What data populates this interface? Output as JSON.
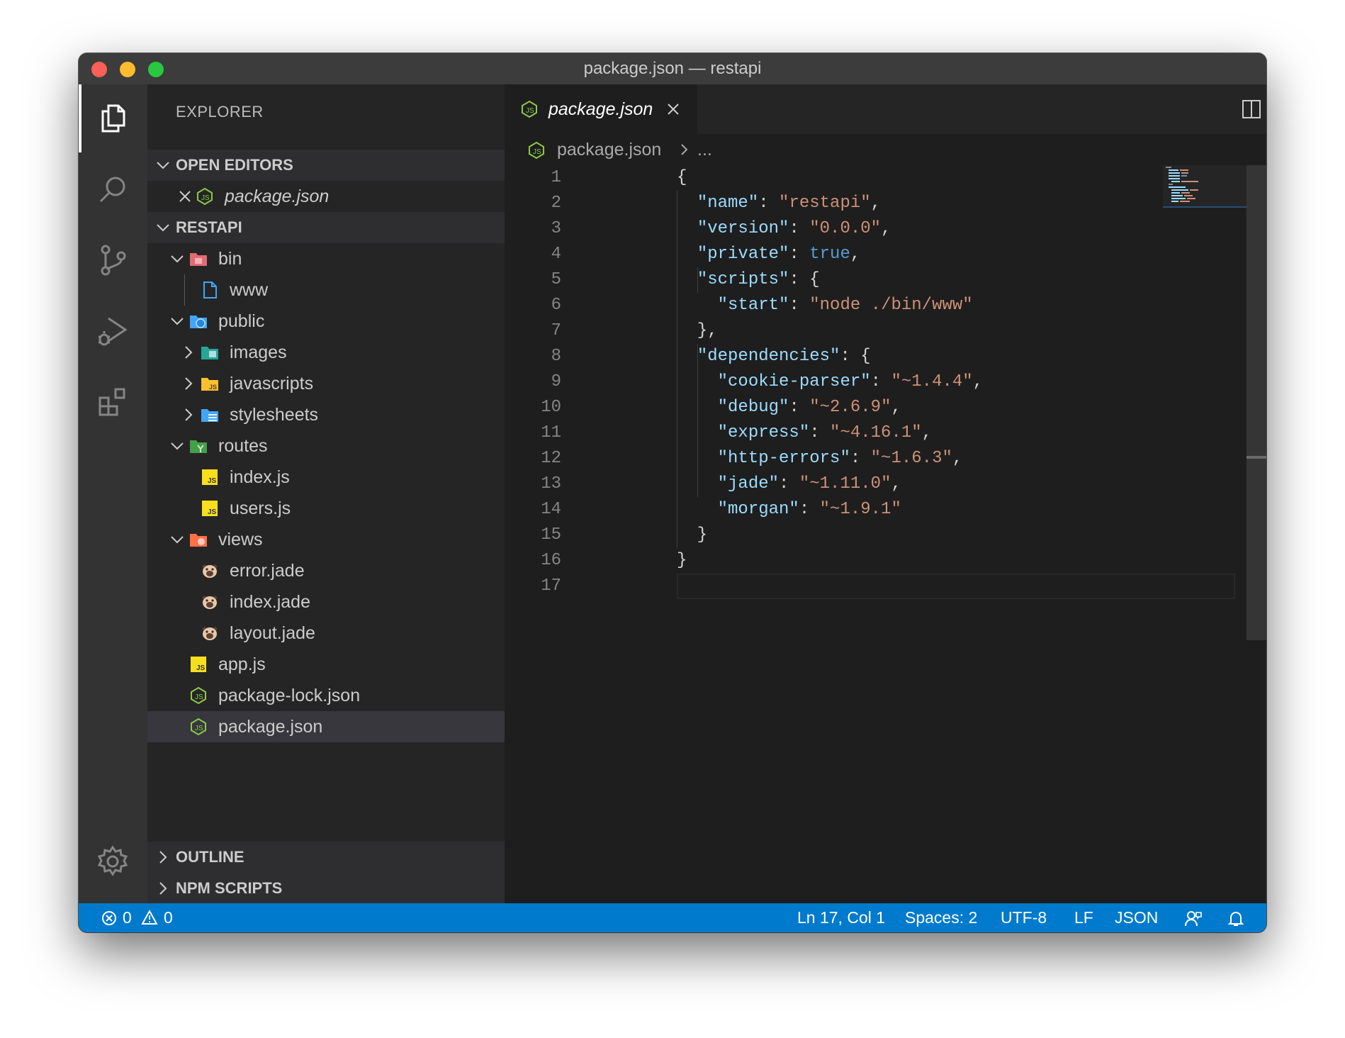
{
  "window": {
    "title": "package.json — restapi"
  },
  "sidebar": {
    "title": "EXPLORER",
    "open_editors": {
      "header": "OPEN EDITORS",
      "items": [
        {
          "label": "package.json"
        }
      ]
    },
    "project": {
      "header": "RESTAPI",
      "tree": [
        {
          "label": "bin"
        },
        {
          "label": "www"
        },
        {
          "label": "public"
        },
        {
          "label": "images"
        },
        {
          "label": "javascripts"
        },
        {
          "label": "stylesheets"
        },
        {
          "label": "routes"
        },
        {
          "label": "index.js"
        },
        {
          "label": "users.js"
        },
        {
          "label": "views"
        },
        {
          "label": "error.jade"
        },
        {
          "label": "index.jade"
        },
        {
          "label": "layout.jade"
        },
        {
          "label": "app.js"
        },
        {
          "label": "package-lock.json"
        },
        {
          "label": "package.json"
        }
      ]
    },
    "outline": {
      "header": "OUTLINE"
    },
    "npm_scripts": {
      "header": "NPM SCRIPTS"
    }
  },
  "editor": {
    "tab": {
      "label": "package.json"
    },
    "breadcrumb": {
      "file": "package.json",
      "more": "..."
    },
    "lines": [
      {
        "n": "1",
        "t": [
          [
            "p",
            "{"
          ]
        ]
      },
      {
        "n": "2",
        "t": [
          [
            "p",
            "  "
          ],
          [
            "k",
            "\"name\""
          ],
          [
            "p",
            ": "
          ],
          [
            "s",
            "\"restapi\""
          ],
          [
            "p",
            ","
          ]
        ]
      },
      {
        "n": "3",
        "t": [
          [
            "p",
            "  "
          ],
          [
            "k",
            "\"version\""
          ],
          [
            "p",
            ": "
          ],
          [
            "s",
            "\"0.0.0\""
          ],
          [
            "p",
            ","
          ]
        ]
      },
      {
        "n": "4",
        "t": [
          [
            "p",
            "  "
          ],
          [
            "k",
            "\"private\""
          ],
          [
            "p",
            ": "
          ],
          [
            "b",
            "true"
          ],
          [
            "p",
            ","
          ]
        ]
      },
      {
        "n": "5",
        "t": [
          [
            "p",
            "  "
          ],
          [
            "k",
            "\"scripts\""
          ],
          [
            "p",
            ": {"
          ]
        ]
      },
      {
        "n": "6",
        "t": [
          [
            "p",
            "    "
          ],
          [
            "k",
            "\"start\""
          ],
          [
            "p",
            ": "
          ],
          [
            "s",
            "\"node ./bin/www\""
          ]
        ]
      },
      {
        "n": "7",
        "t": [
          [
            "p",
            "  },"
          ]
        ]
      },
      {
        "n": "8",
        "t": [
          [
            "p",
            "  "
          ],
          [
            "k",
            "\"dependencies\""
          ],
          [
            "p",
            ": {"
          ]
        ]
      },
      {
        "n": "9",
        "t": [
          [
            "p",
            "    "
          ],
          [
            "k",
            "\"cookie-parser\""
          ],
          [
            "p",
            ": "
          ],
          [
            "s",
            "\"~1.4.4\""
          ],
          [
            "p",
            ","
          ]
        ]
      },
      {
        "n": "10",
        "t": [
          [
            "p",
            "    "
          ],
          [
            "k",
            "\"debug\""
          ],
          [
            "p",
            ": "
          ],
          [
            "s",
            "\"~2.6.9\""
          ],
          [
            "p",
            ","
          ]
        ]
      },
      {
        "n": "11",
        "t": [
          [
            "p",
            "    "
          ],
          [
            "k",
            "\"express\""
          ],
          [
            "p",
            ": "
          ],
          [
            "s",
            "\"~4.16.1\""
          ],
          [
            "p",
            ","
          ]
        ]
      },
      {
        "n": "12",
        "t": [
          [
            "p",
            "    "
          ],
          [
            "k",
            "\"http-errors\""
          ],
          [
            "p",
            ": "
          ],
          [
            "s",
            "\"~1.6.3\""
          ],
          [
            "p",
            ","
          ]
        ]
      },
      {
        "n": "13",
        "t": [
          [
            "p",
            "    "
          ],
          [
            "k",
            "\"jade\""
          ],
          [
            "p",
            ": "
          ],
          [
            "s",
            "\"~1.11.0\""
          ],
          [
            "p",
            ","
          ]
        ]
      },
      {
        "n": "14",
        "t": [
          [
            "p",
            "    "
          ],
          [
            "k",
            "\"morgan\""
          ],
          [
            "p",
            ": "
          ],
          [
            "s",
            "\"~1.9.1\""
          ]
        ]
      },
      {
        "n": "15",
        "t": [
          [
            "p",
            "  }"
          ]
        ]
      },
      {
        "n": "16",
        "t": [
          [
            "p",
            "}"
          ]
        ]
      },
      {
        "n": "17",
        "t": [
          [
            "p",
            ""
          ]
        ]
      }
    ]
  },
  "statusbar": {
    "errors": "0",
    "warnings": "0",
    "cursor": "Ln 17, Col 1",
    "indent": "Spaces: 2",
    "encoding": "UTF-8",
    "eol": "LF",
    "language": "JSON"
  },
  "colors": {
    "accent": "#007acc",
    "json_key": "#9cdcfe",
    "json_string": "#ce9178",
    "json_bool": "#569cd6"
  }
}
